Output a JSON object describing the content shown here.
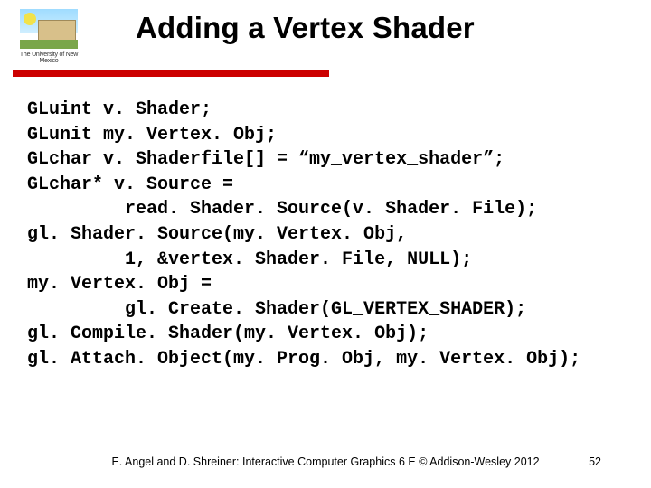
{
  "logo_caption": "The University of New Mexico",
  "title": "Adding a Vertex Shader",
  "code_lines": [
    "GLuint v. Shader;",
    "GLunit my. Vertex. Obj;",
    "GLchar v. Shaderfile[] = “my_vertex_shader”;",
    "GLchar* v. Source =",
    "         read. Shader. Source(v. Shader. File);",
    "gl. Shader. Source(my. Vertex. Obj,",
    "         1, &vertex. Shader. File, NULL);",
    "my. Vertex. Obj =",
    "         gl. Create. Shader(GL_VERTEX_SHADER);",
    "gl. Compile. Shader(my. Vertex. Obj);",
    "gl. Attach. Object(my. Prog. Obj, my. Vertex. Obj);"
  ],
  "footer_cite": "E. Angel and D. Shreiner: Interactive Computer Graphics 6 E © Addison-Wesley 2012",
  "page_number": "52"
}
